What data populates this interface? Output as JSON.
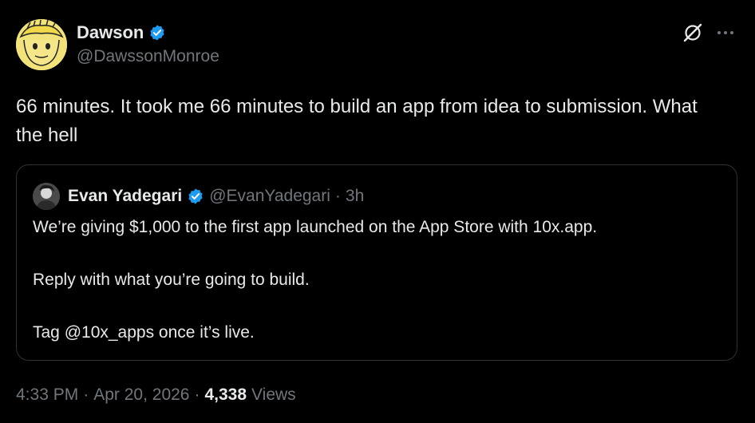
{
  "author": {
    "name": "Dawson",
    "handle": "@DawssonMonroe",
    "verified": true
  },
  "tweet": {
    "text": "66 minutes. It took me 66 minutes to build an app from idea to submission. What the hell"
  },
  "quoted": {
    "name": "Evan Yadegari",
    "handle": "@EvanYadegari",
    "separator": "·",
    "time": "3h",
    "lines": [
      "We’re giving $1,000 to the first app launched on the App Store with 10x.app.",
      "Reply with what you’re going to build.",
      "Tag @10x_apps once it’s live."
    ]
  },
  "meta": {
    "time": "4:33 PM",
    "sep1": "·",
    "date": "Apr 20, 2026",
    "sep2": "·",
    "views_count": "4,338",
    "views_label": "Views"
  },
  "icons": {
    "verified": "verified-badge-icon",
    "grok": "grok-icon",
    "more": "more-icon"
  },
  "colors": {
    "background": "#000000",
    "text": "#e7e9ea",
    "secondary": "#71767b",
    "verified": "#1d9bf0",
    "border": "#2f3336"
  }
}
